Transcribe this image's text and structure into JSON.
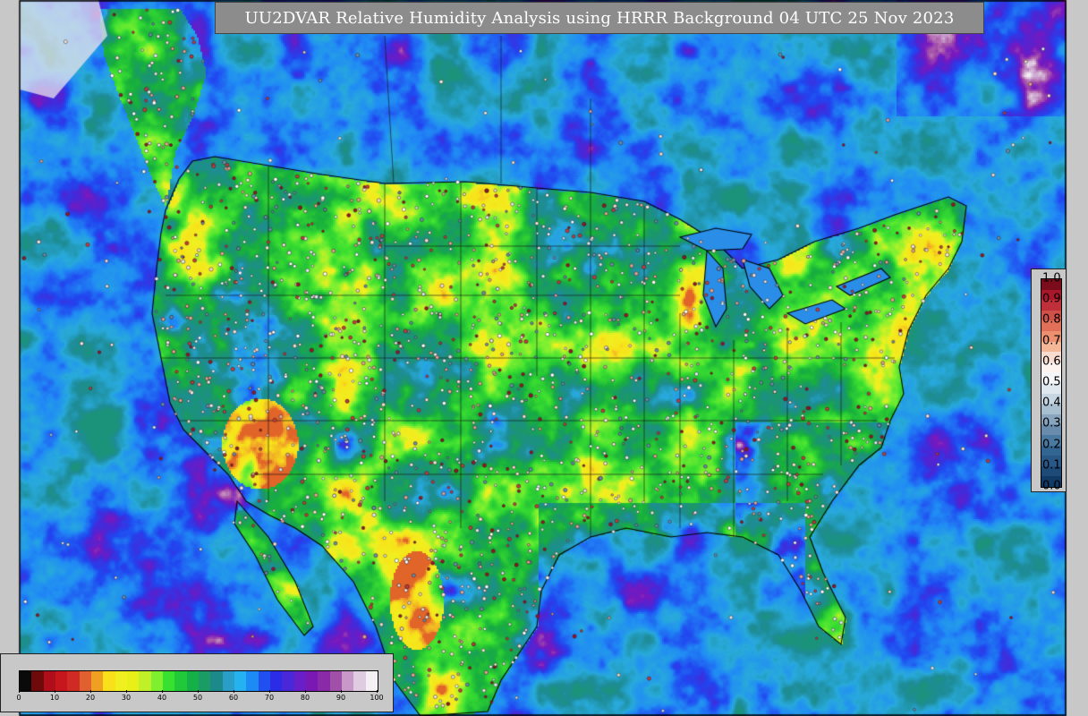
{
  "title": "UU2DVAR Relative Humidity Analysis using HRRR Background 04 UTC 25 Nov 2023",
  "rh_colorbar": {
    "ticks": [
      "0",
      "10",
      "20",
      "30",
      "40",
      "50",
      "60",
      "70",
      "80",
      "90",
      "100"
    ],
    "colors": [
      "#0a0a0a",
      "#6e0a0a",
      "#b00e1a",
      "#c8161e",
      "#d02a24",
      "#e06030",
      "#f0a020",
      "#f8e01a",
      "#f0f020",
      "#e8f018",
      "#c0f028",
      "#7ef030",
      "#38e030",
      "#20c83a",
      "#16b048",
      "#1a9c64",
      "#1c8a8a",
      "#2a9ec8",
      "#24b2f0",
      "#1c8cf4",
      "#2050f0",
      "#2a2ce6",
      "#4a28d8",
      "#6a1ec8",
      "#7a18b4",
      "#8a2aa8",
      "#a050a8",
      "#c898c8",
      "#e0cce0",
      "#f4f0f4"
    ]
  },
  "resid_colorbar": {
    "ticks": [
      "1.0",
      "0.9",
      "0.8",
      "0.7",
      "0.6",
      "0.5",
      "0.4",
      "0.3",
      "0.2",
      "0.1",
      "0.0"
    ],
    "colors": [
      "#7a0c1c",
      "#a8182a",
      "#c0303a",
      "#d0504a",
      "#e07058",
      "#ec9070",
      "#f4b898",
      "#f8dcd0",
      "#fcf2ee",
      "#f4f6f8",
      "#dfe8ee",
      "#c6d6e2",
      "#a8bfd0",
      "#8aa6be",
      "#6a8cac",
      "#4a7aa0",
      "#336592",
      "#2a5886",
      "#1e4a78",
      "#123a66"
    ]
  }
}
